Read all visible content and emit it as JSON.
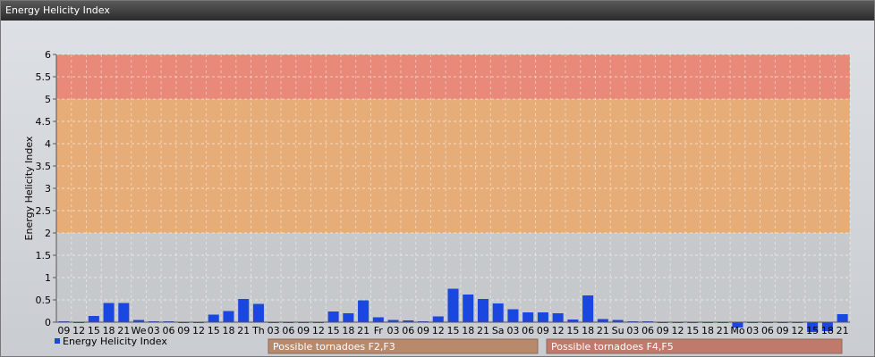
{
  "window": {
    "title": "Energy Helicity Index"
  },
  "chart_data": {
    "type": "bar",
    "ylabel": "Energy Helicity Index",
    "ylim": [
      0,
      6
    ],
    "yticks": [
      "0",
      "0.5",
      "1",
      "1.5",
      "2",
      "2.5",
      "3",
      "3.5",
      "4",
      "4.5",
      "5",
      "5.5",
      "6"
    ],
    "bands": [
      {
        "from": 0,
        "to": 2,
        "color": "#c6c8cb"
      },
      {
        "from": 2,
        "to": 5,
        "color": "#e7a970"
      },
      {
        "from": 5,
        "to": 6,
        "color": "#e98170"
      }
    ],
    "categories": [
      "09",
      "12",
      "15",
      "18",
      "21",
      "We",
      "03",
      "06",
      "09",
      "12",
      "15",
      "18",
      "21",
      "Th",
      "03",
      "06",
      "09",
      "12",
      "15",
      "18",
      "21",
      "Fr",
      "03",
      "06",
      "09",
      "12",
      "15",
      "18",
      "21",
      "Sa",
      "03",
      "06",
      "09",
      "12",
      "15",
      "18",
      "21",
      "Su",
      "03",
      "06",
      "09",
      "12",
      "15",
      "18",
      "21",
      "Mo",
      "03",
      "06",
      "09",
      "12",
      "15",
      "18",
      "21"
    ],
    "series": [
      {
        "name": "Energy Helicity Index",
        "color": "#1a47e0",
        "values": [
          0.02,
          0.01,
          0.14,
          0.43,
          0.43,
          0.05,
          0.02,
          0.02,
          0.01,
          0.01,
          0.17,
          0.25,
          0.52,
          0.41,
          0.01,
          0.01,
          0.01,
          0.01,
          0.24,
          0.2,
          0.49,
          0.11,
          0.05,
          0.04,
          0.02,
          0.13,
          0.75,
          0.62,
          0.52,
          0.42,
          0.29,
          0.22,
          0.22,
          0.2,
          0.06,
          0.6,
          0.07,
          0.05,
          0.02,
          0.02,
          0.01,
          0.01,
          0.01,
          0.01,
          0.01,
          -0.12,
          0.01,
          0.01,
          0.01,
          0.01,
          -0.22,
          -0.2,
          0.18
        ]
      }
    ],
    "legend": {
      "position": "bottom-left",
      "label": "Energy Helicity Index"
    },
    "threshold_boxes": [
      {
        "label": "Possible tornadoes F2,F3",
        "color": "#b8896a"
      },
      {
        "label": "Possible tornadoes F4,F5",
        "color": "#bf7a6c"
      }
    ],
    "grid": true
  }
}
